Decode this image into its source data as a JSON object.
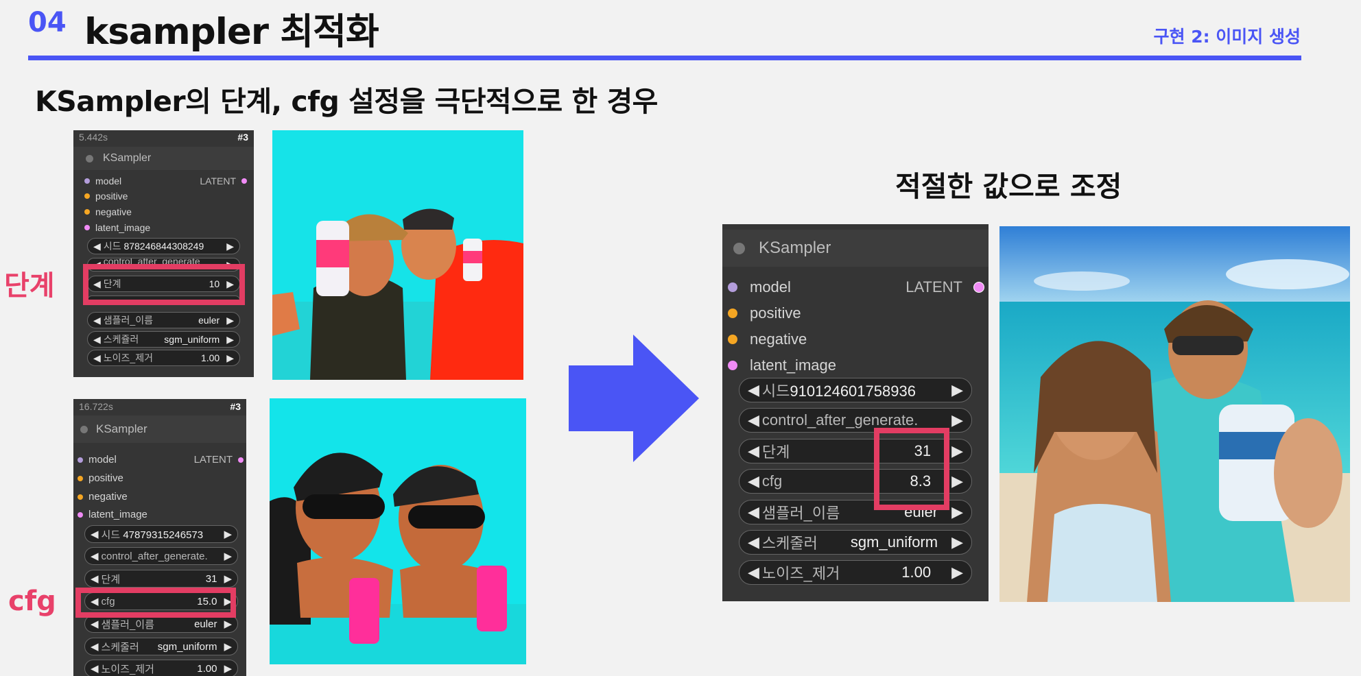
{
  "header": {
    "section_number": "04",
    "title": "ksampler 최적화",
    "section_label": "구현 2: 이미지 생성"
  },
  "subtitle": "KSampler의 단계, cfg 설정을 극단적으로 한 경우",
  "right_title": "적절한 값으로 조정",
  "labels": {
    "steps": "단계",
    "cfg": "cfg"
  },
  "node1": {
    "time": "5.442s",
    "id": "#3",
    "name": "KSampler",
    "inputs": [
      "model",
      "positive",
      "negative",
      "latent_image"
    ],
    "output": "LATENT",
    "seed_label": "시드",
    "seed": "878246844308249",
    "control": "control_after_generate",
    "steps_label": "단계",
    "steps": "10",
    "sampler_label": "샘플러_이름",
    "sampler": "euler",
    "scheduler_label": "스케쥴러",
    "scheduler": "sgm_uniform",
    "denoise_label": "노이즈_제거",
    "denoise": "1.00"
  },
  "node2": {
    "time": "16.722s",
    "id": "#3",
    "name": "KSampler",
    "inputs": [
      "model",
      "positive",
      "negative",
      "latent_image"
    ],
    "output": "LATENT",
    "seed_label": "시드",
    "seed": "47879315246573",
    "control": "control_after_generate.",
    "steps_label": "단계",
    "steps": "31",
    "cfg_label": "cfg",
    "cfg": "15.0",
    "sampler_label": "샘플러_이름",
    "sampler": "euler",
    "scheduler_label": "스케줄러",
    "scheduler": "sgm_uniform",
    "denoise_label": "노이즈_제거",
    "denoise": "1.00"
  },
  "node3": {
    "name": "KSampler",
    "inputs": [
      "model",
      "positive",
      "negative",
      "latent_image"
    ],
    "output": "LATENT",
    "seed_label": "시드",
    "seed": "910124601758936",
    "control": "control_after_generate.",
    "steps_label": "단계",
    "steps": "31",
    "cfg_label": "cfg",
    "cfg": "8.3",
    "sampler_label": "샘플러_이름",
    "sampler": "euler",
    "scheduler_label": "스케줄러",
    "scheduler": "sgm_uniform",
    "denoise_label": "노이즈_제거",
    "denoise": "1.00"
  },
  "colors": {
    "accent": "#4a55f5",
    "highlight": "#e33d63",
    "node_bg": "#353535"
  }
}
